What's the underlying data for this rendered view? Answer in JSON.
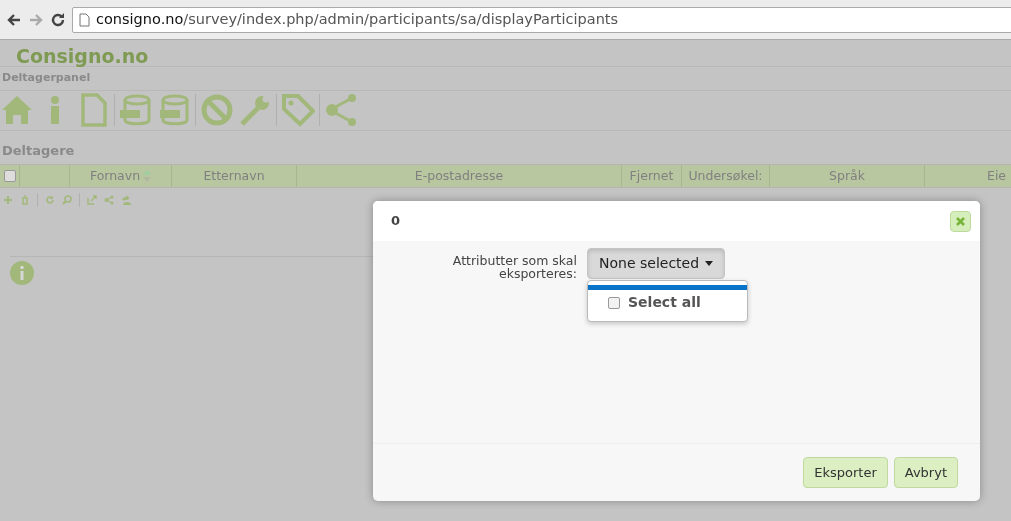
{
  "browser": {
    "url_host": "consigno.no",
    "url_path": "/survey/index.php/admin/participants/sa/displayParticipants"
  },
  "site": {
    "title": "Consigno.no"
  },
  "panel": {
    "title": "Deltagerpanel"
  },
  "section": {
    "title": "Deltagere"
  },
  "table": {
    "select_all": {
      "checked": false
    },
    "columns": [
      {
        "label": "Fornavn",
        "sorted": true
      },
      {
        "label": "Etternavn"
      },
      {
        "label": "E-postadresse"
      },
      {
        "label": "Fjernet"
      },
      {
        "label": "Undersøkel:"
      },
      {
        "label": "Språk"
      },
      {
        "label": "Eie"
      }
    ]
  },
  "dialog": {
    "title": "0",
    "field_label": "Attributter som skal eksporteres:",
    "dropdown": {
      "value": "None selected",
      "expanded": true,
      "options": [
        {
          "label": "Select all",
          "checked": false,
          "highlighted": true
        }
      ]
    },
    "buttons": [
      "Eksporter",
      "Avbryt"
    ]
  }
}
